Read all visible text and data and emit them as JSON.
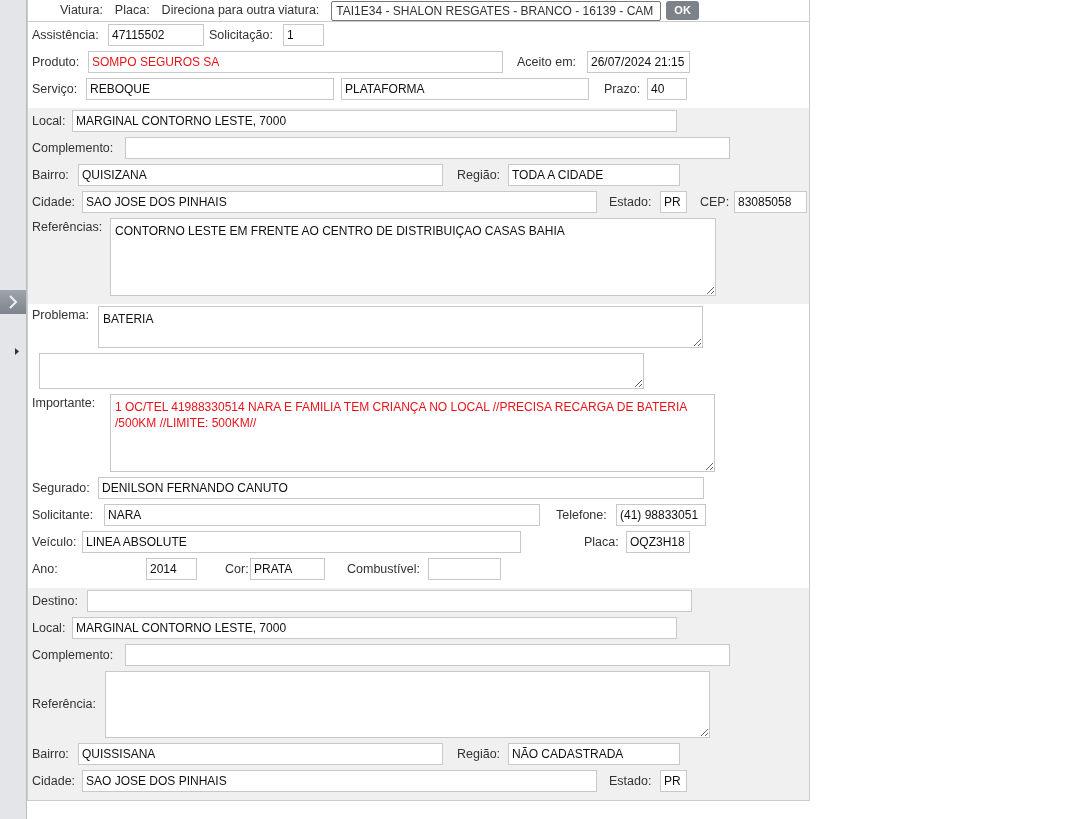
{
  "top_bar": {
    "labels": [
      "Viatura:",
      "Placa:",
      "Direciona para outra viatura:"
    ],
    "select_value": "TAI1E34 - SHALON RESGATES - BRANCO - 16139 - CAM",
    "button": "OK"
  },
  "sections": [
    {
      "shaded": false,
      "rows": [
        {
          "fields": [
            {
              "kind": "input",
              "label": "Assistência:",
              "value": "47115502",
              "warning": false
            },
            {
              "kind": "input",
              "label": "Solicitação:",
              "value": "1",
              "warning": false
            }
          ]
        },
        {
          "fields": [
            {
              "kind": "input",
              "label": "Produto:",
              "value": "SOMPO SEGUROS SA",
              "warning": true
            },
            {
              "kind": "input",
              "label": "Aceito em:",
              "value": "26/07/2024 21:15",
              "warning": false
            }
          ]
        },
        {
          "fields": [
            {
              "kind": "input",
              "label": "Serviço:",
              "value": "REBOQUE",
              "warning": false
            },
            {
              "kind": "input",
              "value": "PLATAFORMA",
              "warning": false
            },
            {
              "kind": "input",
              "label": "Prazo:",
              "value": "40",
              "warning": false
            }
          ]
        }
      ]
    },
    {
      "shaded": true,
      "rows": [
        {
          "fields": [
            {
              "kind": "input",
              "label": "Local:",
              "value": "MARGINAL CONTORNO LESTE, 7000",
              "warning": false
            }
          ]
        },
        {
          "fields": [
            {
              "kind": "input",
              "label": "Complemento:"
            }
          ]
        },
        {
          "fields": [
            {
              "kind": "input",
              "label": "Bairro:",
              "value": "QUISIZANA",
              "warning": false
            },
            {
              "kind": "input",
              "label": "Região:",
              "value": "TODA A CIDADE",
              "warning": false
            }
          ]
        },
        {
          "fields": [
            {
              "kind": "input",
              "label": "Cidade:",
              "value": "SAO JOSE DOS PINHAIS",
              "warning": false
            },
            {
              "kind": "input",
              "label": "Estado:",
              "value": "PR",
              "warning": false
            },
            {
              "kind": "input",
              "label": "CEP:",
              "value": "83085058",
              "warning": false
            }
          ]
        },
        {
          "fields": [
            {
              "kind": "textarea",
              "label": "Referências:",
              "value": "CONTORNO LESTE EM FRENTE AO CENTRO DE DISTRIBUIÇAO CASAS BAHIA",
              "warning": false
            }
          ]
        }
      ]
    },
    {
      "shaded": false,
      "rows": [
        {
          "fields": [
            {
              "kind": "textarea",
              "label": "Problema:",
              "value": "BATERIA",
              "warning": false
            }
          ]
        },
        {
          "fields": [
            {
              "kind": "textarea"
            }
          ]
        },
        {
          "fields": [
            {
              "kind": "textarea",
              "label": "Importante:",
              "value": "1 OC/TEL 41988330514 NARA E FAMILIA TEM CRIANÇA NO LOCAL //PRECISA RECARGA DE BATERIA /500KM //LIMITE: 500KM//",
              "warning": true
            }
          ]
        },
        {
          "fields": [
            {
              "kind": "input",
              "label": "Segurado:",
              "value": "DENILSON FERNANDO CANUTO",
              "warning": false
            }
          ]
        },
        {
          "fields": [
            {
              "kind": "input",
              "label": "Solicitante:",
              "value": "NARA",
              "warning": false
            },
            {
              "kind": "input",
              "label": "Telefone:",
              "value": "(41) 98833051",
              "warning": false
            }
          ]
        },
        {
          "fields": [
            {
              "kind": "input",
              "label": "Veículo:",
              "value": "LINEA ABSOLUTE",
              "warning": false
            },
            {
              "kind": "input",
              "label": "Placa:",
              "value": "OQZ3H18",
              "warning": false
            }
          ]
        },
        {
          "fields": [
            {
              "kind": "input",
              "label": "Ano:",
              "value": "2014",
              "warning": false
            },
            {
              "kind": "input",
              "label": "Cor:",
              "value": "PRATA",
              "warning": false
            },
            {
              "kind": "input",
              "label": "Combustível:"
            }
          ]
        }
      ]
    },
    {
      "shaded": true,
      "rows": [
        {
          "fields": [
            {
              "kind": "input",
              "label": "Destino:"
            }
          ]
        },
        {
          "fields": [
            {
              "kind": "input",
              "label": "Local:",
              "value": "MARGINAL CONTORNO LESTE, 7000",
              "warning": false
            }
          ]
        },
        {
          "fields": [
            {
              "kind": "input",
              "label": "Complemento:"
            }
          ]
        },
        {
          "fields": [
            {
              "kind": "textarea",
              "label": "Referência:"
            }
          ]
        },
        {
          "fields": [
            {
              "kind": "input",
              "label": "Bairro:",
              "value": "QUISSISANA",
              "warning": false
            },
            {
              "kind": "input",
              "label": "Região:",
              "value": "NÃO CADASTRADA",
              "warning": false
            }
          ]
        },
        {
          "fields": [
            {
              "kind": "input",
              "label": "Cidade:",
              "value": "SAO JOSE DOS PINHAIS",
              "warning": false
            },
            {
              "kind": "input",
              "label": "Estado:",
              "value": "PR",
              "warning": false
            }
          ]
        }
      ]
    }
  ]
}
